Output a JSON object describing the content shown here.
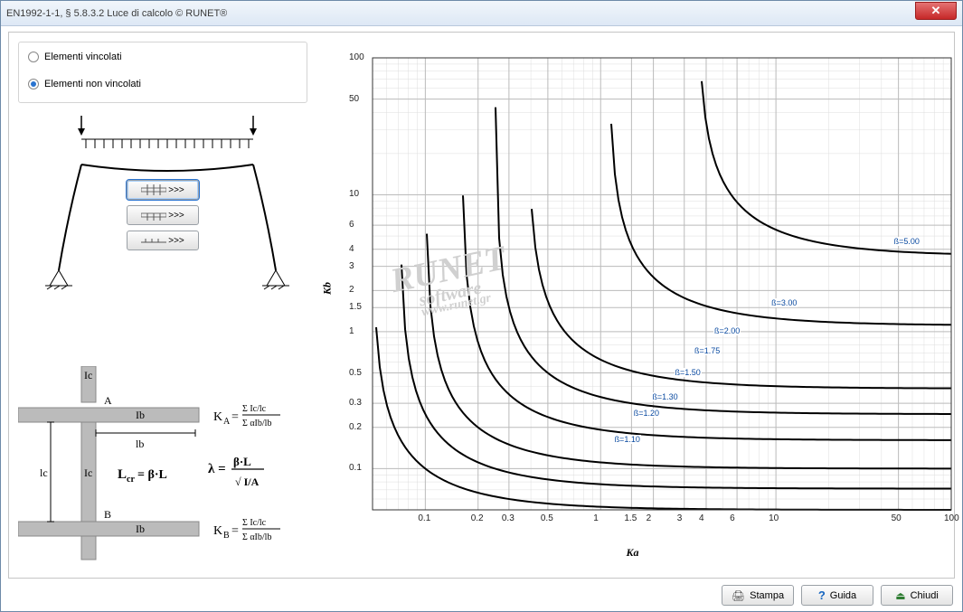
{
  "window": {
    "title": "EN1992-1-1, § 5.8.3.2  Luce di calcolo © RUNET®"
  },
  "radios": {
    "constrained": "Elementi vincolati",
    "unconstrained": "Elementi non vincolati",
    "selected": "unconstrained"
  },
  "model_buttons": {
    "b1_tooltip": ">>>",
    "b2_tooltip": ">>>",
    "b3_tooltip": ">>>"
  },
  "diagram_labels": {
    "Ic": "Ic",
    "Ib": "Ib",
    "lb": "lb",
    "lc": "lc",
    "A": "A",
    "B": "B",
    "KA_eq": "K",
    "KA_sub": "A",
    "KB_eq": "K",
    "KB_sub": "B",
    "Lcr": "L",
    "Lcr_sub": "cr",
    "eq_sym": "= β·L",
    "lambda": "λ",
    "lambda_eq": "= β·L / √(I/A)"
  },
  "buttons": {
    "print": "Stampa",
    "help": "Guida",
    "close": "Chiudi"
  },
  "chart_data": {
    "type": "line",
    "xlabel": "Ka",
    "ylabel": "Kb",
    "x_scale": "log",
    "y_scale": "log",
    "xlim": [
      0.05,
      100
    ],
    "ylim": [
      0.05,
      100
    ],
    "x_ticks": [
      0.1,
      0.2,
      0.3,
      0.5,
      1,
      1.5,
      2,
      3,
      4,
      6,
      10,
      50,
      100
    ],
    "y_ticks": [
      0.1,
      0.2,
      0.3,
      0.5,
      1,
      1.5,
      2,
      3,
      4,
      6,
      10,
      50,
      100
    ],
    "series": [
      {
        "name": "β=1.10",
        "beta": 1.1
      },
      {
        "name": "β=1.20",
        "beta": 1.2
      },
      {
        "name": "β=1.30",
        "beta": 1.3
      },
      {
        "name": "β=1.50",
        "beta": 1.5
      },
      {
        "name": "β=1.75",
        "beta": 1.75
      },
      {
        "name": "β=2.00",
        "beta": 2.0
      },
      {
        "name": "β=3.00",
        "beta": 3.0
      },
      {
        "name": "β=5.00",
        "beta": 5.0
      }
    ],
    "note": "Nomogram curves of constant β in (Ka,Kb) log-log space; values on curves as labeled."
  },
  "watermark": {
    "line1": "RUNET",
    "line2": "software",
    "line3": "www.runet.gr"
  }
}
